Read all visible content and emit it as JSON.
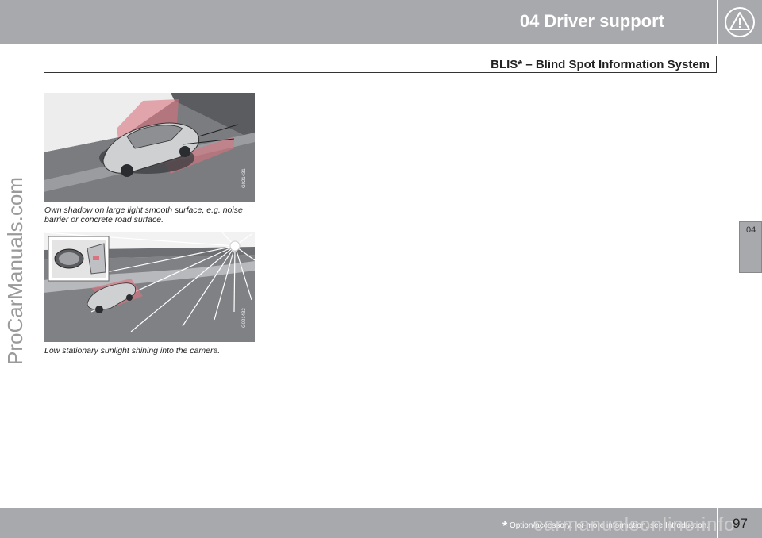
{
  "header": {
    "chapter_title": "04  Driver support",
    "section_title": "BLIS* – Blind Spot Information System",
    "icon": "warning-triangle-icon"
  },
  "side_tab": {
    "label": "04"
  },
  "watermark": "ProCarManuals.com",
  "figures": [
    {
      "code": "G021431",
      "caption": "Own shadow on large light smooth surface, e.g. noise barrier or concrete road surface."
    },
    {
      "code": "G021432",
      "caption": "Low stationary sunlight shining into the camera."
    }
  ],
  "footer": {
    "footnote_star": "*",
    "footnote_text": "Option/accessory, for more information, see Introduction.",
    "page_number": "97",
    "watermark_right": "carmanualsonline.info"
  },
  "colors": {
    "bar_gray": "#a8a9ad",
    "accent_pink": "#d9737f"
  }
}
